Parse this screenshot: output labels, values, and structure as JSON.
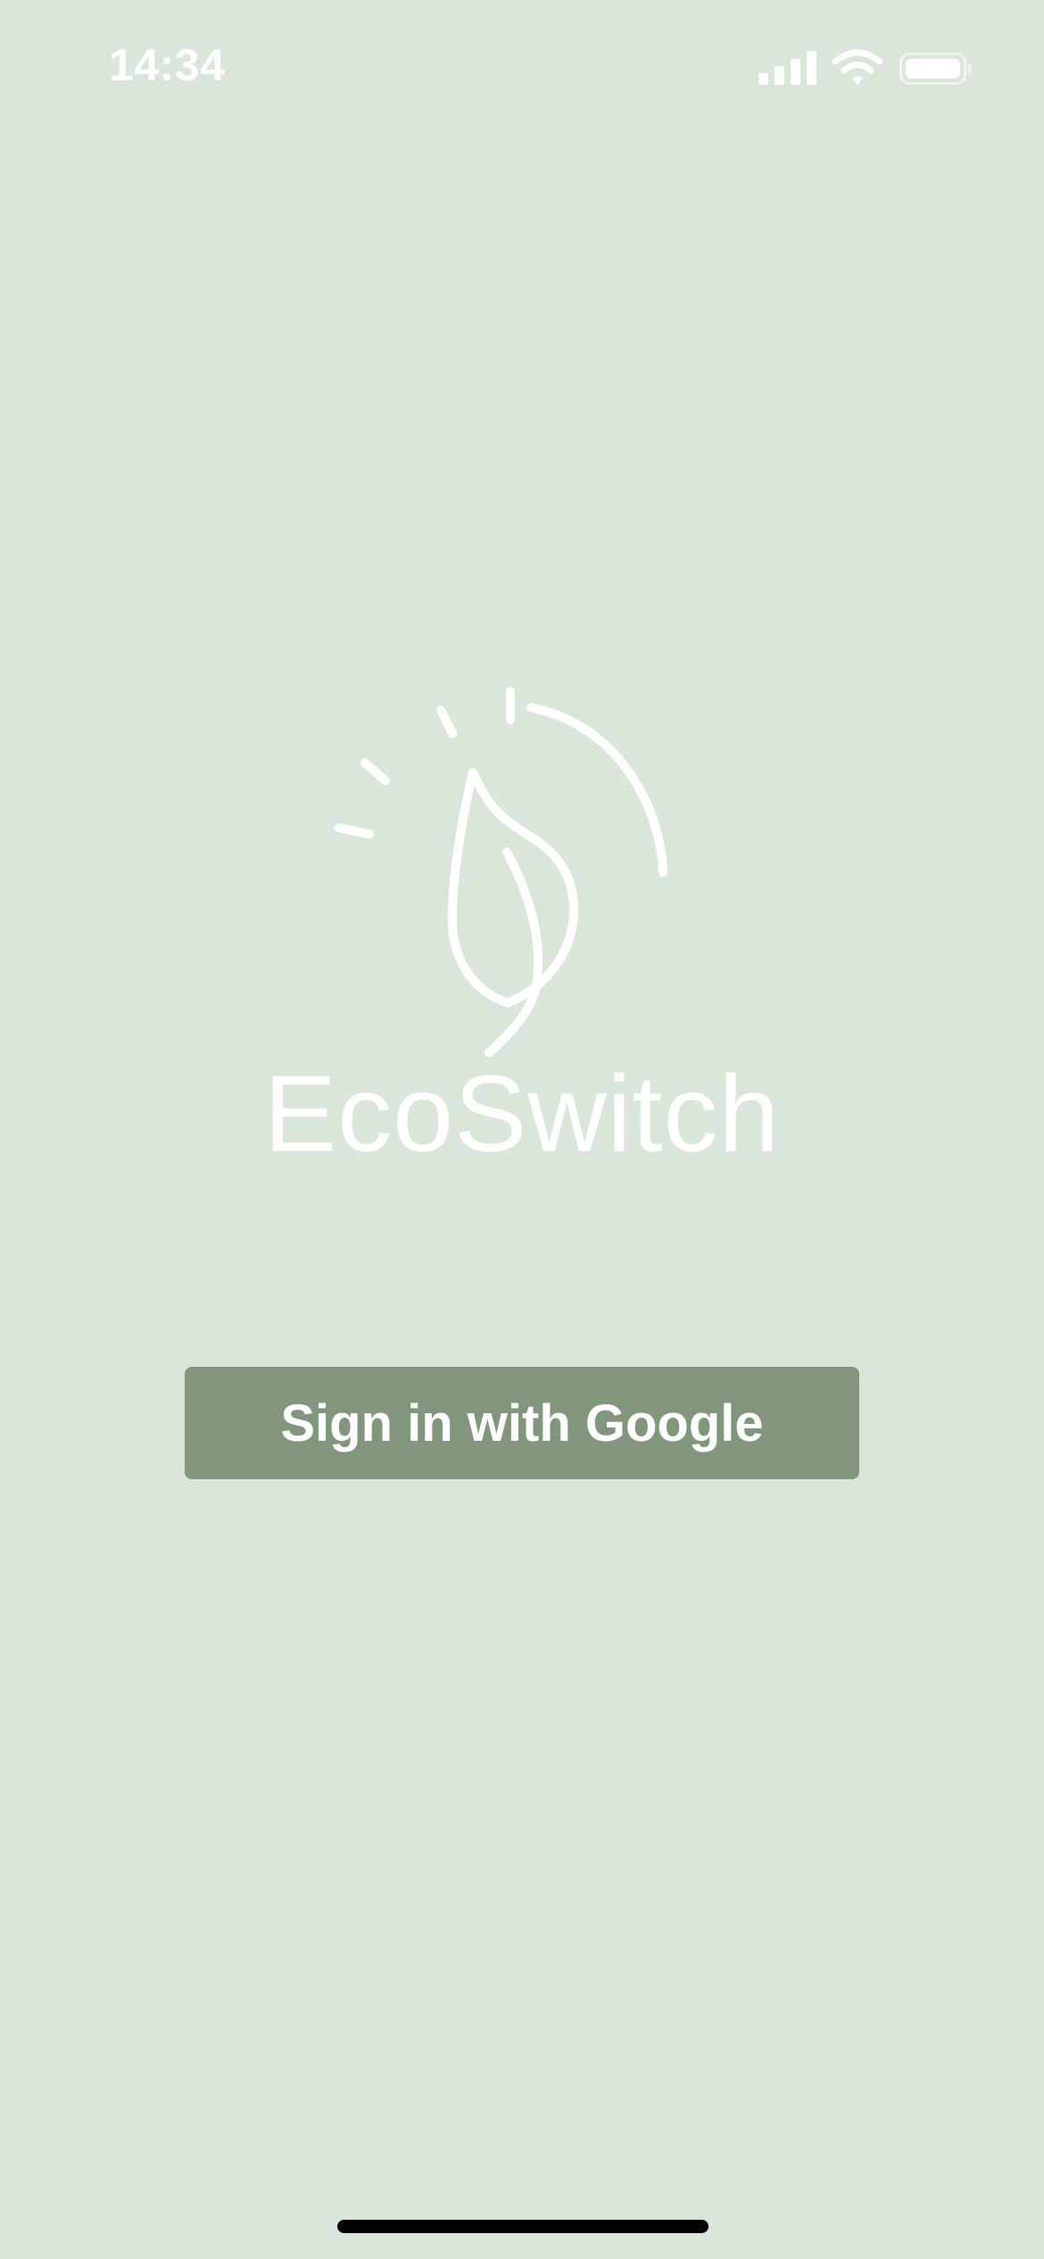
{
  "status_bar": {
    "time": "14:34",
    "icons": [
      "signal-icon",
      "wifi-icon",
      "battery-icon"
    ]
  },
  "logo": {
    "icon": "leaf-sun-icon",
    "wordmark": "EcoSwitch"
  },
  "auth": {
    "google_button_label": "Sign in with Google"
  },
  "colors": {
    "background": "#dbe6da",
    "button": "#82967e",
    "logo": "#ffffff",
    "button_text": "#ffffff"
  }
}
